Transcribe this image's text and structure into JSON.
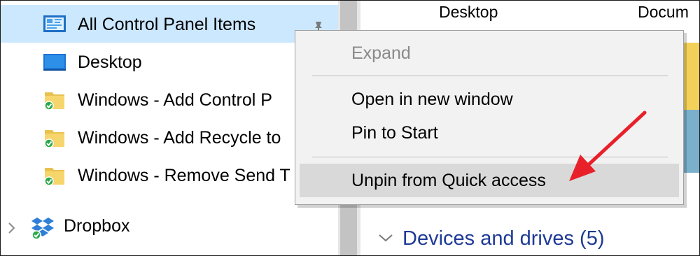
{
  "nav": {
    "items": [
      {
        "label": "All Control Panel Items",
        "icon": "control-panel-icon",
        "selected": true,
        "pinned": true
      },
      {
        "label": "Desktop",
        "icon": "desktop-icon"
      },
      {
        "label": "Windows - Add Control P",
        "icon": "folder-synced-icon"
      },
      {
        "label": "Windows - Add Recycle to",
        "icon": "folder-synced-icon"
      },
      {
        "label": "Windows - Remove Send T",
        "icon": "folder-synced-icon"
      }
    ],
    "dropbox": {
      "label": "Dropbox",
      "icon": "dropbox-icon"
    }
  },
  "content": {
    "folders": [
      {
        "label": "Desktop"
      },
      {
        "label": "Docum"
      }
    ],
    "section": {
      "label": "Devices and drives (5)"
    }
  },
  "context_menu": {
    "items": [
      {
        "label": "Expand",
        "disabled": true
      },
      {
        "label": "Open in new window"
      },
      {
        "label": "Pin to Start"
      },
      {
        "label": "Unpin from Quick access",
        "highlighted": true
      }
    ]
  },
  "colors": {
    "selection": "#cce8ff",
    "section_header": "#1e3a96",
    "annotation_arrow": "#e8202a"
  }
}
